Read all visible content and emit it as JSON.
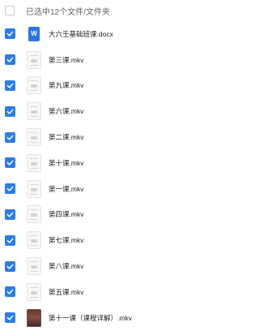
{
  "header": {
    "title": "已选中12个文件/文件夹"
  },
  "colors": {
    "accent": "#2b7de9",
    "doc": "#2f72e6"
  },
  "files": [
    {
      "name": "大六壬基础班课.docx",
      "icon": "word-doc-icon",
      "checked": true
    },
    {
      "name": "第三课.mkv",
      "icon": "video-thumbnail",
      "checked": true
    },
    {
      "name": "第九课.mkv",
      "icon": "video-thumbnail",
      "checked": true
    },
    {
      "name": "第六课.mkv",
      "icon": "video-thumbnail",
      "checked": true
    },
    {
      "name": "第二课.mkv",
      "icon": "video-thumbnail",
      "checked": true
    },
    {
      "name": "第十课.mkv",
      "icon": "video-thumbnail",
      "checked": true
    },
    {
      "name": "第一课.mkv",
      "icon": "video-thumbnail",
      "checked": true
    },
    {
      "name": "第四课.mkv",
      "icon": "video-thumbnail",
      "checked": true
    },
    {
      "name": "第七课.mkv",
      "icon": "video-thumbnail",
      "checked": true
    },
    {
      "name": "第八课.mkv",
      "icon": "video-thumbnail",
      "checked": true
    },
    {
      "name": "第五课.mkv",
      "icon": "video-thumbnail",
      "checked": true
    },
    {
      "name": "第十一课（课程详解）.mkv",
      "icon": "video-thumbnail-photo",
      "checked": true
    }
  ]
}
